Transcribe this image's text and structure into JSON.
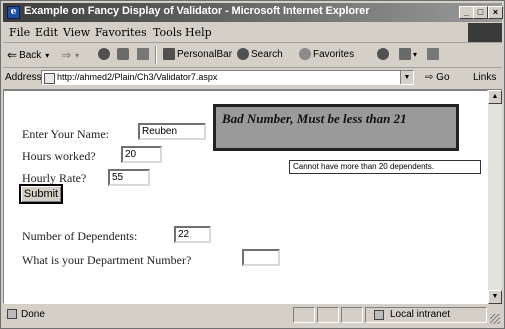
{
  "window": {
    "title": "Example on Fancy Display of Validator - Microsoft Internet Explorer",
    "buttons": {
      "minimize": "_",
      "maximize": "□",
      "close": "×"
    }
  },
  "menu": {
    "items": [
      "File",
      "Edit",
      "View",
      "Favorites",
      "Tools",
      "Help"
    ]
  },
  "toolbar": {
    "back": "Back",
    "search": "Search",
    "favorites": "Favorites",
    "personal_bar": "PersonalBar"
  },
  "address": {
    "label": "Address",
    "url": "http://ahmed2/Plain/Ch3/Validator7.aspx",
    "go": "Go",
    "links": "Links"
  },
  "form": {
    "name_label": "Enter Your Name:",
    "name_value": "Reuben",
    "hours_label": "Hours worked?",
    "hours_value": "20",
    "rate_label": "Hourly Rate?",
    "rate_value": "55",
    "dependents_label": "Number of Dependents:",
    "dependents_value": "22",
    "department_label": "What is your Department Number?",
    "department_value": "",
    "department_error": "Cannot have more than 20 dependents.",
    "summary_error": "Bad Number, Must be less than 21",
    "submit_label": "Submit"
  },
  "status": {
    "text": "Done",
    "zone": "Local intranet"
  }
}
